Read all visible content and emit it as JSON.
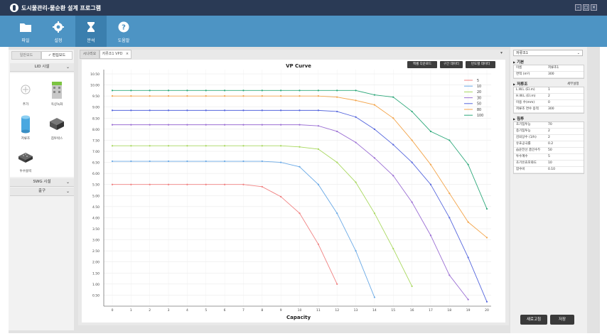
{
  "app": {
    "title": "도시물관리-물순환 설계 프로그램"
  },
  "toolbar": {
    "items": [
      {
        "label": "파일",
        "icon": "folder-icon"
      },
      {
        "label": "설정",
        "icon": "gear-icon"
      },
      {
        "label": "분석",
        "icon": "hourglass-icon"
      },
      {
        "label": "도움말",
        "icon": "help-icon"
      }
    ]
  },
  "left": {
    "tabs": [
      "일반모드",
      "✓ 편집모드"
    ],
    "sections": {
      "lid": "LID 시설",
      "swg": "SWG 시설",
      "outlet": "출구"
    },
    "tiles": [
      "추가",
      "옥상녹화",
      "저류조",
      "침투박스",
      "투수블럭"
    ]
  },
  "center": {
    "tabs": [
      "시나리오",
      "저류조1 VPD",
      "×"
    ],
    "buttons": [
      "엑셀 다운로드",
      "구간 데이터",
      "빈도별 데이터"
    ],
    "menu_arrow": "▾"
  },
  "chart_data": {
    "type": "line",
    "title": "VP Curve",
    "xlabel": "Capacity",
    "ylabel": "",
    "x": [
      0,
      1,
      2,
      3,
      4,
      5,
      6,
      7,
      8,
      9,
      10,
      11,
      12,
      13,
      14,
      15,
      16,
      17,
      18,
      19,
      20
    ],
    "xlim": [
      0,
      20
    ],
    "ylim": [
      0,
      10.5
    ],
    "yticks": [
      0.5,
      1.0,
      1.5,
      2.0,
      2.5,
      3.0,
      3.5,
      4.0,
      4.5,
      5.0,
      5.5,
      6.0,
      6.5,
      7.0,
      7.5,
      8.0,
      8.5,
      9.0,
      9.5,
      10.0,
      10.5
    ],
    "ytick_labels": [
      "0.50",
      "1.00",
      "1.50",
      "2.00",
      "2.50",
      "3.00",
      "3.50",
      "4.00",
      "4.50",
      "5.00",
      "5.50",
      "6.00",
      "6.50",
      "7.00",
      "7.50",
      "8.00",
      "8.50",
      "9.00",
      "9.50",
      "10.00",
      "10.50"
    ],
    "grid": true,
    "legend": "top-right",
    "series": [
      {
        "name": "5",
        "color": "#f08080",
        "values": [
          5.5,
          5.5,
          5.5,
          5.5,
          5.5,
          5.5,
          5.5,
          5.5,
          5.4,
          4.95,
          4.2,
          2.8,
          1.0,
          -0.5,
          null,
          null,
          null,
          null,
          null,
          null,
          null
        ]
      },
      {
        "name": "10",
        "color": "#6aa9e6",
        "values": [
          6.55,
          6.55,
          6.55,
          6.55,
          6.55,
          6.55,
          6.55,
          6.55,
          6.55,
          6.5,
          6.3,
          5.5,
          4.2,
          2.5,
          0.4,
          null,
          null,
          null,
          null,
          null,
          null
        ]
      },
      {
        "name": "20",
        "color": "#a8d85e",
        "values": [
          7.25,
          7.25,
          7.25,
          7.25,
          7.25,
          7.25,
          7.25,
          7.25,
          7.25,
          7.25,
          7.2,
          7.1,
          6.5,
          5.6,
          4.2,
          2.6,
          0.9,
          -0.3,
          null,
          null,
          null
        ]
      },
      {
        "name": "30",
        "color": "#9b6fd4",
        "values": [
          8.2,
          8.2,
          8.2,
          8.2,
          8.2,
          8.2,
          8.2,
          8.2,
          8.2,
          8.2,
          8.2,
          8.15,
          7.9,
          7.4,
          6.7,
          5.9,
          4.7,
          3.2,
          1.4,
          0.3,
          null
        ]
      },
      {
        "name": "50",
        "color": "#5566dd",
        "values": [
          8.85,
          8.85,
          8.85,
          8.85,
          8.85,
          8.85,
          8.85,
          8.85,
          8.85,
          8.85,
          8.85,
          8.85,
          8.8,
          8.55,
          8.0,
          7.3,
          6.5,
          5.5,
          4.0,
          2.2,
          0.2
        ]
      },
      {
        "name": "80",
        "color": "#f3a54c",
        "values": [
          9.5,
          9.5,
          9.5,
          9.5,
          9.5,
          9.5,
          9.5,
          9.5,
          9.5,
          9.5,
          9.5,
          9.5,
          9.45,
          9.3,
          9.1,
          8.5,
          7.5,
          6.4,
          5.1,
          3.8,
          3.1
        ]
      },
      {
        "name": "100",
        "color": "#2da87a",
        "values": [
          9.75,
          9.75,
          9.75,
          9.75,
          9.75,
          9.75,
          9.75,
          9.75,
          9.75,
          9.75,
          9.75,
          9.75,
          9.75,
          9.75,
          9.55,
          9.45,
          8.8,
          7.9,
          7.5,
          6.4,
          4.4
        ]
      }
    ]
  },
  "right": {
    "dropdown": "저류조1",
    "basic_title": "기본",
    "basic_rows": [
      {
        "k": "이름",
        "v": "저류조1"
      },
      {
        "k": "면적 (m²)",
        "v": "300"
      }
    ],
    "storage_title": "저류조",
    "storage_link": "세부설정",
    "storage_rows": [
      {
        "k": "L.W.L (El.m)",
        "v": "1"
      },
      {
        "k": "H.W.L (El.m)",
        "v": "2"
      },
      {
        "k": "이용 수(mm)",
        "v": "0"
      },
      {
        "k": "저류조 면수 용적",
        "v": "300"
      }
    ],
    "infil_title": "침투",
    "infil_rows": [
      {
        "k": "초기침투능",
        "v": "70"
      },
      {
        "k": "종기침투능",
        "v": "2"
      },
      {
        "k": "감쇠상수 (1/h)",
        "v": "2"
      },
      {
        "k": "유효공극률",
        "v": "0.2"
      },
      {
        "k": "습윤전선 흡인수두",
        "v": "50"
      },
      {
        "k": "투수계수",
        "v": "5"
      },
      {
        "k": "초기유효포화도",
        "v": "10"
      },
      {
        "k": "함수비",
        "v": "0.10"
      }
    ],
    "buttons": {
      "refresh": "새로고침",
      "save": "저장"
    }
  }
}
